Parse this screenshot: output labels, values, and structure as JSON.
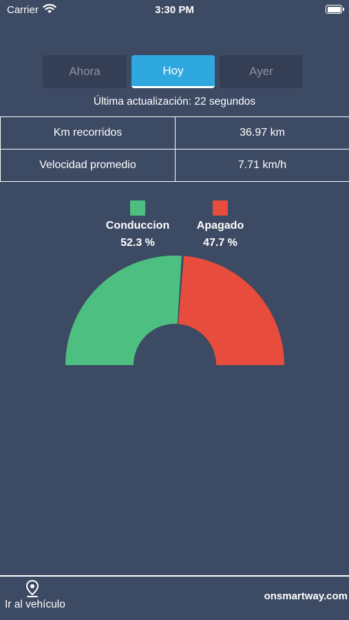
{
  "status_bar": {
    "carrier": "Carrier",
    "time": "3:30 PM"
  },
  "tabs": [
    {
      "label": "Ahora",
      "active": false
    },
    {
      "label": "Hoy",
      "active": true
    },
    {
      "label": "Ayer",
      "active": false
    }
  ],
  "last_update": "Última actualización: 22 segundos",
  "stats": [
    {
      "label": "Km recorridos",
      "value": "36.97 km"
    },
    {
      "label": "Velocidad promedio",
      "value": "7.71 km/h"
    }
  ],
  "chart_data": {
    "type": "pie",
    "shape": "half-donut",
    "series": [
      {
        "name": "Conduccion",
        "value": 52.3,
        "label": "52.3 %",
        "color": "#4dbf80"
      },
      {
        "name": "Apagado",
        "value": 47.7,
        "label": "47.7 %",
        "color": "#e74c3c"
      }
    ]
  },
  "footer": {
    "link_label": "Ir al vehículo",
    "brand": "onsmartway.com",
    "link_icon": "location-pin-icon"
  }
}
